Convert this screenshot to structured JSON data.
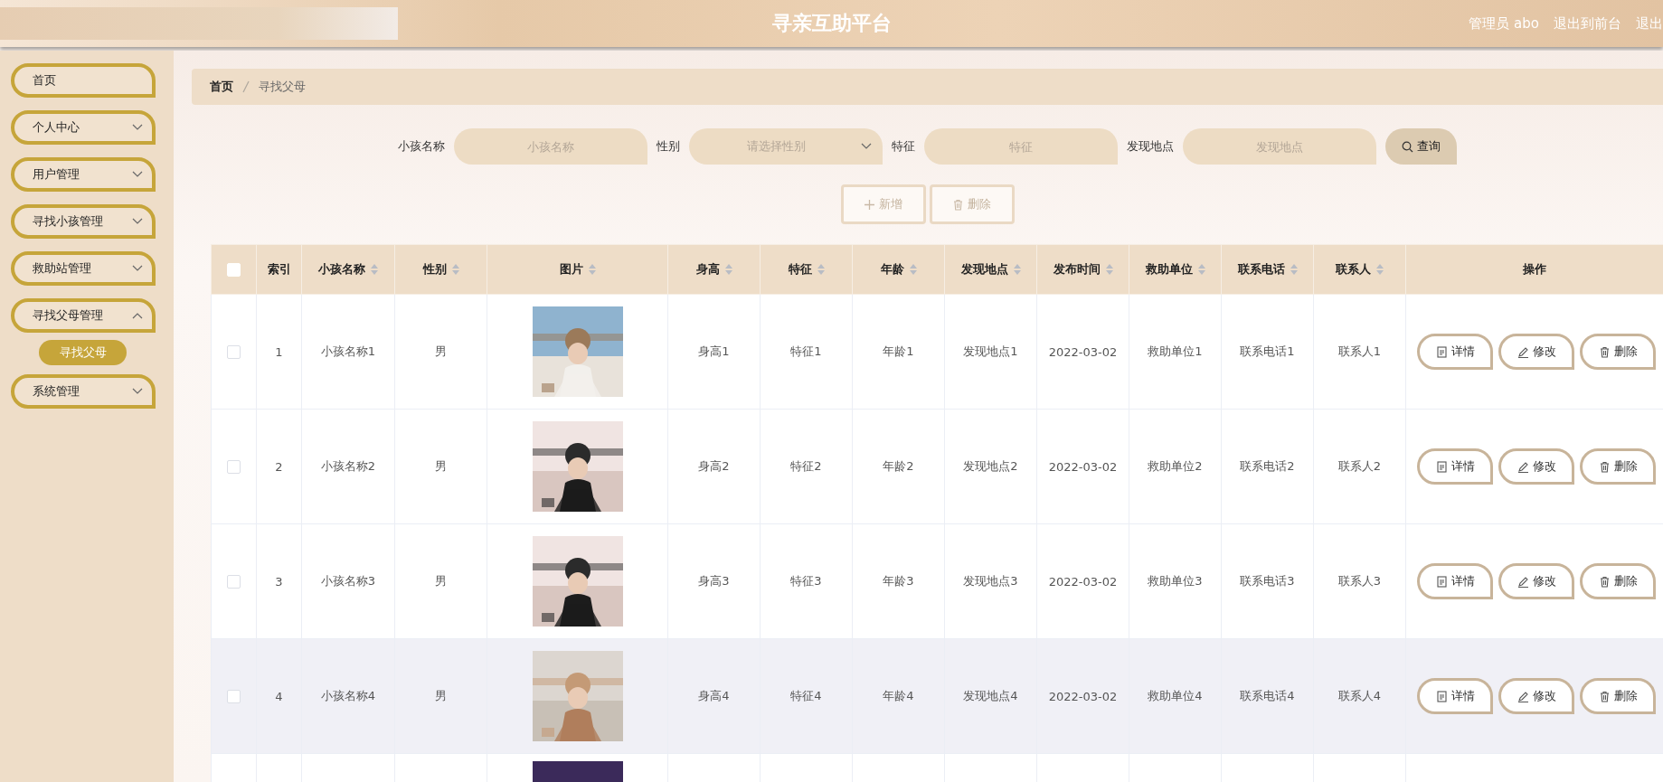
{
  "header": {
    "title": "寻亲互助平台",
    "links": [
      "管理员 abo",
      "退出到前台",
      "退出"
    ]
  },
  "sidebar": {
    "items": [
      {
        "label": "首页",
        "expandable": false
      },
      {
        "label": "个人中心",
        "expandable": true,
        "expanded": false
      },
      {
        "label": "用户管理",
        "expandable": true,
        "expanded": false
      },
      {
        "label": "寻找小孩管理",
        "expandable": true,
        "expanded": false
      },
      {
        "label": "救助站管理",
        "expandable": true,
        "expanded": false
      },
      {
        "label": "寻找父母管理",
        "expandable": true,
        "expanded": true,
        "children": [
          {
            "label": "寻找父母",
            "selected": true
          }
        ]
      },
      {
        "label": "系统管理",
        "expandable": true,
        "expanded": false
      }
    ]
  },
  "breadcrumb": [
    "首页",
    "寻找父母"
  ],
  "search": {
    "fields": [
      {
        "label": "小孩名称",
        "kind": "text",
        "placeholder": "小孩名称"
      },
      {
        "label": "性别",
        "kind": "select",
        "placeholder": "请选择性别"
      },
      {
        "label": "特征",
        "kind": "text",
        "placeholder": "特征"
      },
      {
        "label": "发现地点",
        "kind": "text",
        "placeholder": "发现地点"
      }
    ],
    "button": "查询"
  },
  "toolbar": [
    {
      "label": "新增",
      "kind": "add",
      "disabled": true
    },
    {
      "label": "删除",
      "kind": "delete",
      "disabled": true
    }
  ],
  "table": {
    "all_checked": false,
    "columns": [
      {
        "label": "索引",
        "sortable": false
      },
      {
        "label": "小孩名称",
        "sortable": true
      },
      {
        "label": "性别",
        "sortable": true
      },
      {
        "label": "图片",
        "sortable": true
      },
      {
        "label": "身高",
        "sortable": true
      },
      {
        "label": "特征",
        "sortable": true
      },
      {
        "label": "年龄",
        "sortable": true
      },
      {
        "label": "发现地点",
        "sortable": true
      },
      {
        "label": "发布时间",
        "sortable": true
      },
      {
        "label": "救助单位",
        "sortable": true
      },
      {
        "label": "联系电话",
        "sortable": true
      },
      {
        "label": "联系人",
        "sortable": true
      },
      {
        "label": "操作",
        "sortable": false
      }
    ],
    "rows": [
      {
        "checked": false,
        "highlighted": false,
        "cells": [
          "1",
          "小孩名称1",
          "男",
          {
            "kind": "picture"
          },
          "身高1",
          "特征1",
          "年龄1",
          "发现地点1",
          "2022-03-02",
          "救助单位1",
          "联系电话1",
          "联系人1"
        ],
        "actions": [
          {
            "label": "详情",
            "kind": "detail"
          },
          {
            "label": "修改",
            "kind": "edit"
          },
          {
            "label": "删除",
            "kind": "delete"
          }
        ]
      },
      {
        "checked": false,
        "highlighted": false,
        "cells": [
          "2",
          "小孩名称2",
          "男",
          {
            "kind": "picture"
          },
          "身高2",
          "特征2",
          "年龄2",
          "发现地点2",
          "2022-03-02",
          "救助单位2",
          "联系电话2",
          "联系人2"
        ],
        "actions": [
          {
            "label": "详情",
            "kind": "detail"
          },
          {
            "label": "修改",
            "kind": "edit"
          },
          {
            "label": "删除",
            "kind": "delete"
          }
        ]
      },
      {
        "checked": false,
        "highlighted": false,
        "cells": [
          "3",
          "小孩名称3",
          "男",
          {
            "kind": "picture"
          },
          "身高3",
          "特征3",
          "年龄3",
          "发现地点3",
          "2022-03-02",
          "救助单位3",
          "联系电话3",
          "联系人3"
        ],
        "actions": [
          {
            "label": "详情",
            "kind": "detail"
          },
          {
            "label": "修改",
            "kind": "edit"
          },
          {
            "label": "删除",
            "kind": "delete"
          }
        ]
      },
      {
        "checked": false,
        "highlighted": true,
        "cells": [
          "4",
          "小孩名称4",
          "男",
          {
            "kind": "picture"
          },
          "身高4",
          "特征4",
          "年龄4",
          "发现地点4",
          "2022-03-02",
          "救助单位4",
          "联系电话4",
          "联系人4"
        ],
        "actions": [
          {
            "label": "详情",
            "kind": "detail"
          },
          {
            "label": "修改",
            "kind": "edit"
          },
          {
            "label": "删除",
            "kind": "delete"
          }
        ]
      },
      {
        "cells": [
          null,
          null,
          null,
          {
            "kind": "picture"
          }
        ]
      }
    ]
  }
}
